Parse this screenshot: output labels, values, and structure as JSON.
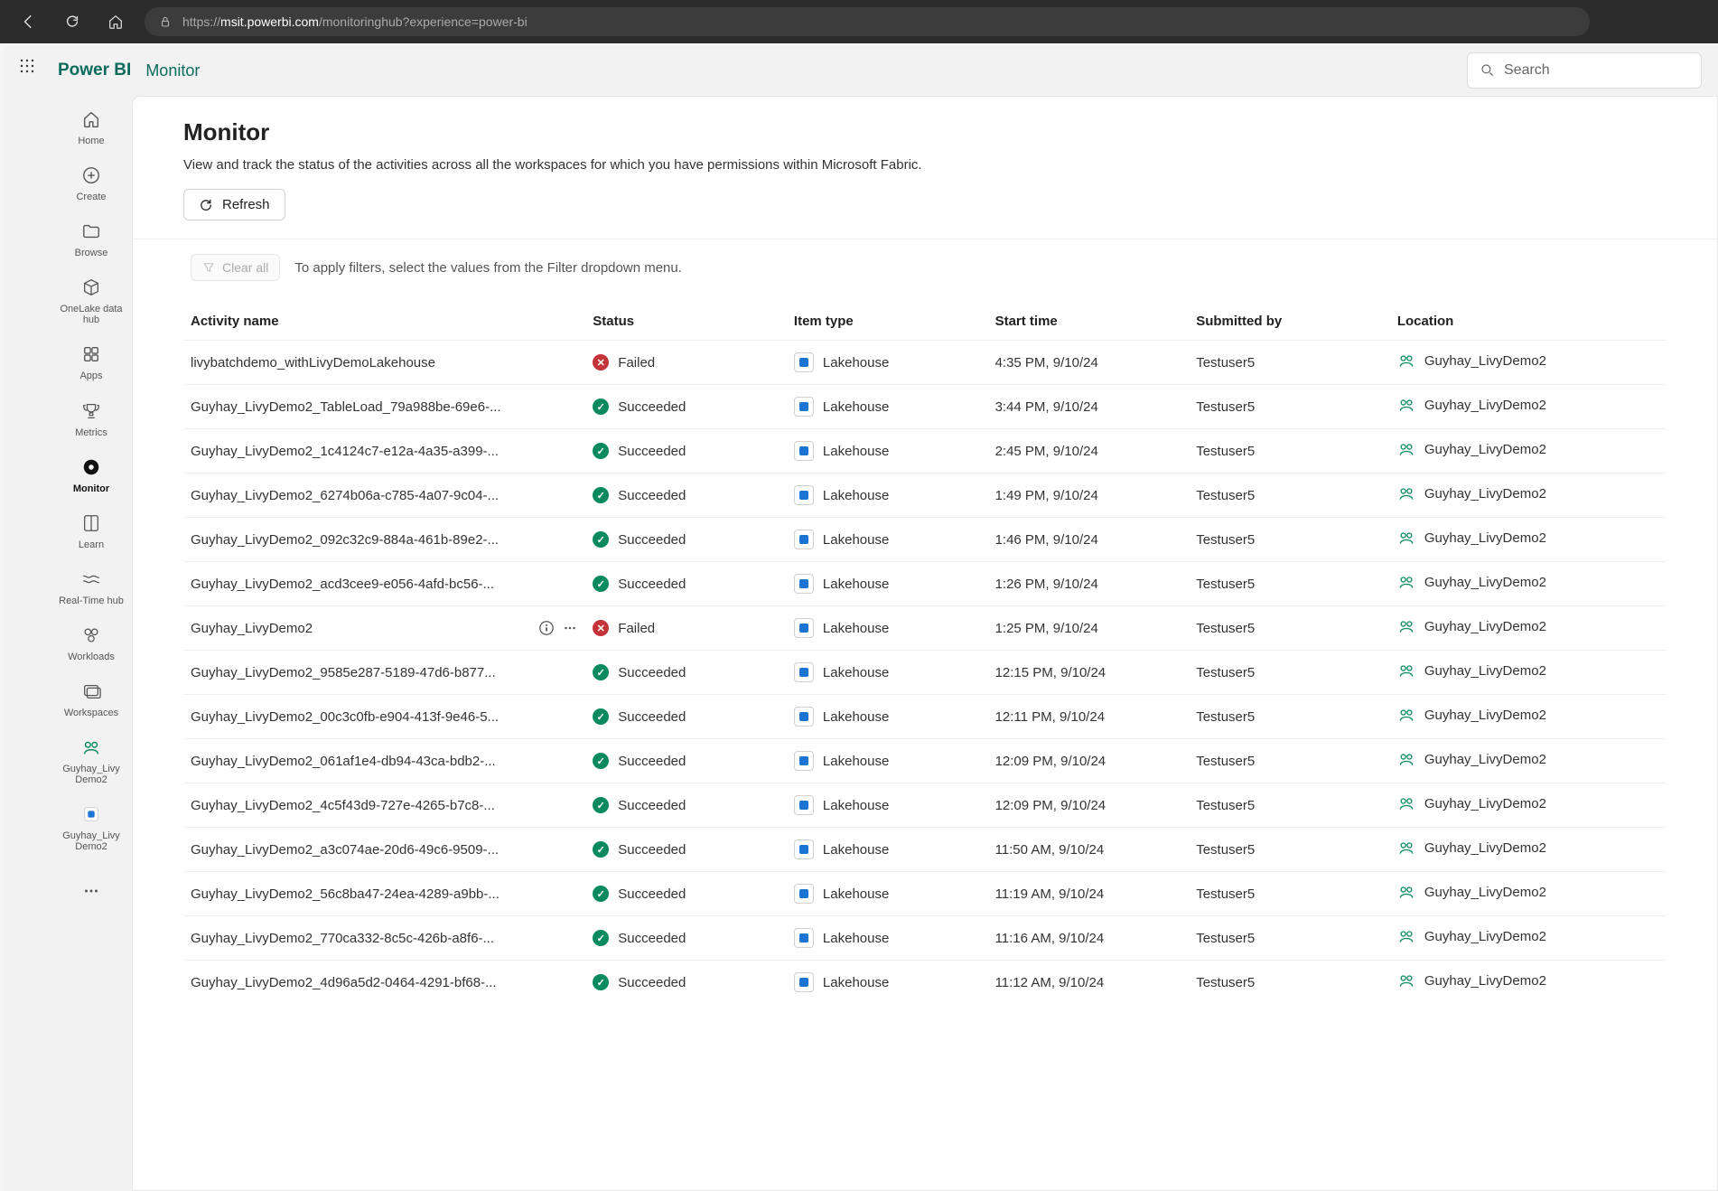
{
  "browser": {
    "url_host": "msit.powerbi.com",
    "url_path": "/monitoringhub?experience=power-bi"
  },
  "header": {
    "brand": "Power BI",
    "breadcrumb": "Monitor",
    "search_placeholder": "Search"
  },
  "nav": {
    "items": [
      {
        "id": "home",
        "label": "Home",
        "icon": "home"
      },
      {
        "id": "create",
        "label": "Create",
        "icon": "plus-circle"
      },
      {
        "id": "browse",
        "label": "Browse",
        "icon": "folder"
      },
      {
        "id": "onelake",
        "label": "OneLake data hub",
        "icon": "cube"
      },
      {
        "id": "apps",
        "label": "Apps",
        "icon": "apps"
      },
      {
        "id": "metrics",
        "label": "Metrics",
        "icon": "trophy"
      },
      {
        "id": "monitor",
        "label": "Monitor",
        "icon": "monitor",
        "active": true
      },
      {
        "id": "learn",
        "label": "Learn",
        "icon": "book"
      },
      {
        "id": "realtime",
        "label": "Real-Time hub",
        "icon": "stream"
      },
      {
        "id": "workloads",
        "label": "Workloads",
        "icon": "workload"
      },
      {
        "id": "workspaces",
        "label": "Workspaces",
        "icon": "workspaces"
      },
      {
        "id": "guyhay1",
        "label": "Guyhay_Livy Demo2",
        "icon": "workspace-green"
      },
      {
        "id": "guyhay2",
        "label": "Guyhay_Livy Demo2",
        "icon": "lakehouse"
      }
    ]
  },
  "page": {
    "title": "Monitor",
    "description": "View and track the status of the activities across all the workspaces for which you have permissions within Microsoft Fabric.",
    "refresh_label": "Refresh",
    "clear_label": "Clear all",
    "filter_hint": "To apply filters, select the values from the Filter dropdown menu."
  },
  "table": {
    "columns": {
      "activity_name": "Activity name",
      "status": "Status",
      "item_type": "Item type",
      "start_time": "Start time",
      "submitted_by": "Submitted by",
      "location": "Location"
    },
    "status_labels": {
      "Succeeded": "Succeeded",
      "Failed": "Failed"
    },
    "rows": [
      {
        "name": "livybatchdemo_withLivyDemoLakehouse",
        "status": "Failed",
        "item_type": "Lakehouse",
        "start_time": "4:35 PM, 9/10/24",
        "submitted_by": "Testuser5",
        "location": "Guyhay_LivyDemo2"
      },
      {
        "name": "Guyhay_LivyDemo2_TableLoad_79a988be-69e6-...",
        "status": "Succeeded",
        "item_type": "Lakehouse",
        "start_time": "3:44 PM, 9/10/24",
        "submitted_by": "Testuser5",
        "location": "Guyhay_LivyDemo2"
      },
      {
        "name": "Guyhay_LivyDemo2_1c4124c7-e12a-4a35-a399-...",
        "status": "Succeeded",
        "item_type": "Lakehouse",
        "start_time": "2:45 PM, 9/10/24",
        "submitted_by": "Testuser5",
        "location": "Guyhay_LivyDemo2"
      },
      {
        "name": "Guyhay_LivyDemo2_6274b06a-c785-4a07-9c04-...",
        "status": "Succeeded",
        "item_type": "Lakehouse",
        "start_time": "1:49 PM, 9/10/24",
        "submitted_by": "Testuser5",
        "location": "Guyhay_LivyDemo2"
      },
      {
        "name": "Guyhay_LivyDemo2_092c32c9-884a-461b-89e2-...",
        "status": "Succeeded",
        "item_type": "Lakehouse",
        "start_time": "1:46 PM, 9/10/24",
        "submitted_by": "Testuser5",
        "location": "Guyhay_LivyDemo2"
      },
      {
        "name": "Guyhay_LivyDemo2_acd3cee9-e056-4afd-bc56-...",
        "status": "Succeeded",
        "item_type": "Lakehouse",
        "start_time": "1:26 PM, 9/10/24",
        "submitted_by": "Testuser5",
        "location": "Guyhay_LivyDemo2"
      },
      {
        "name": "Guyhay_LivyDemo2",
        "status": "Failed",
        "item_type": "Lakehouse",
        "start_time": "1:25 PM, 9/10/24",
        "submitted_by": "Testuser5",
        "location": "Guyhay_LivyDemo2",
        "hovered": true
      },
      {
        "name": "Guyhay_LivyDemo2_9585e287-5189-47d6-b877...",
        "status": "Succeeded",
        "item_type": "Lakehouse",
        "start_time": "12:15 PM, 9/10/24",
        "submitted_by": "Testuser5",
        "location": "Guyhay_LivyDemo2"
      },
      {
        "name": "Guyhay_LivyDemo2_00c3c0fb-e904-413f-9e46-5...",
        "status": "Succeeded",
        "item_type": "Lakehouse",
        "start_time": "12:11 PM, 9/10/24",
        "submitted_by": "Testuser5",
        "location": "Guyhay_LivyDemo2"
      },
      {
        "name": "Guyhay_LivyDemo2_061af1e4-db94-43ca-bdb2-...",
        "status": "Succeeded",
        "item_type": "Lakehouse",
        "start_time": "12:09 PM, 9/10/24",
        "submitted_by": "Testuser5",
        "location": "Guyhay_LivyDemo2"
      },
      {
        "name": "Guyhay_LivyDemo2_4c5f43d9-727e-4265-b7c8-...",
        "status": "Succeeded",
        "item_type": "Lakehouse",
        "start_time": "12:09 PM, 9/10/24",
        "submitted_by": "Testuser5",
        "location": "Guyhay_LivyDemo2"
      },
      {
        "name": "Guyhay_LivyDemo2_a3c074ae-20d6-49c6-9509-...",
        "status": "Succeeded",
        "item_type": "Lakehouse",
        "start_time": "11:50 AM, 9/10/24",
        "submitted_by": "Testuser5",
        "location": "Guyhay_LivyDemo2"
      },
      {
        "name": "Guyhay_LivyDemo2_56c8ba47-24ea-4289-a9bb-...",
        "status": "Succeeded",
        "item_type": "Lakehouse",
        "start_time": "11:19 AM, 9/10/24",
        "submitted_by": "Testuser5",
        "location": "Guyhay_LivyDemo2"
      },
      {
        "name": "Guyhay_LivyDemo2_770ca332-8c5c-426b-a8f6-...",
        "status": "Succeeded",
        "item_type": "Lakehouse",
        "start_time": "11:16 AM, 9/10/24",
        "submitted_by": "Testuser5",
        "location": "Guyhay_LivyDemo2"
      },
      {
        "name": "Guyhay_LivyDemo2_4d96a5d2-0464-4291-bf68-...",
        "status": "Succeeded",
        "item_type": "Lakehouse",
        "start_time": "11:12 AM, 9/10/24",
        "submitted_by": "Testuser5",
        "location": "Guyhay_LivyDemo2"
      }
    ]
  }
}
